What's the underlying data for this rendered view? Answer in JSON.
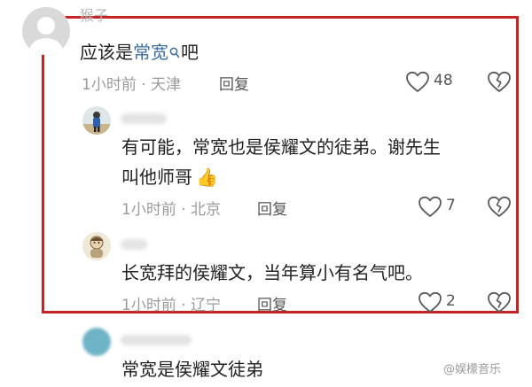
{
  "comments": [
    {
      "username": "猴子",
      "text_prefix": "应该是",
      "text_link": "常宽",
      "text_suffix": "吧",
      "time": "1小时前 · 天津",
      "reply_label": "回复",
      "likes": "48"
    },
    {
      "username": "",
      "text_line1": "有可能，常宽也是侯耀文的徒弟。谢先生",
      "text_line2": "叫他师哥",
      "emoji": "👍",
      "time": "1小时前 · 北京",
      "reply_label": "回复",
      "likes": "7"
    },
    {
      "username": "",
      "text": "长宽拜的侯耀文，当年算小有名气吧。",
      "time": "1小时前 · 辽宁",
      "reply_label": "回复",
      "likes": "2"
    },
    {
      "username": "",
      "text": "常宽是侯耀文徒弟"
    }
  ],
  "watermark": "@娱檬音乐",
  "colors": {
    "highlight": "#c62424",
    "link": "#3a6ea5"
  }
}
